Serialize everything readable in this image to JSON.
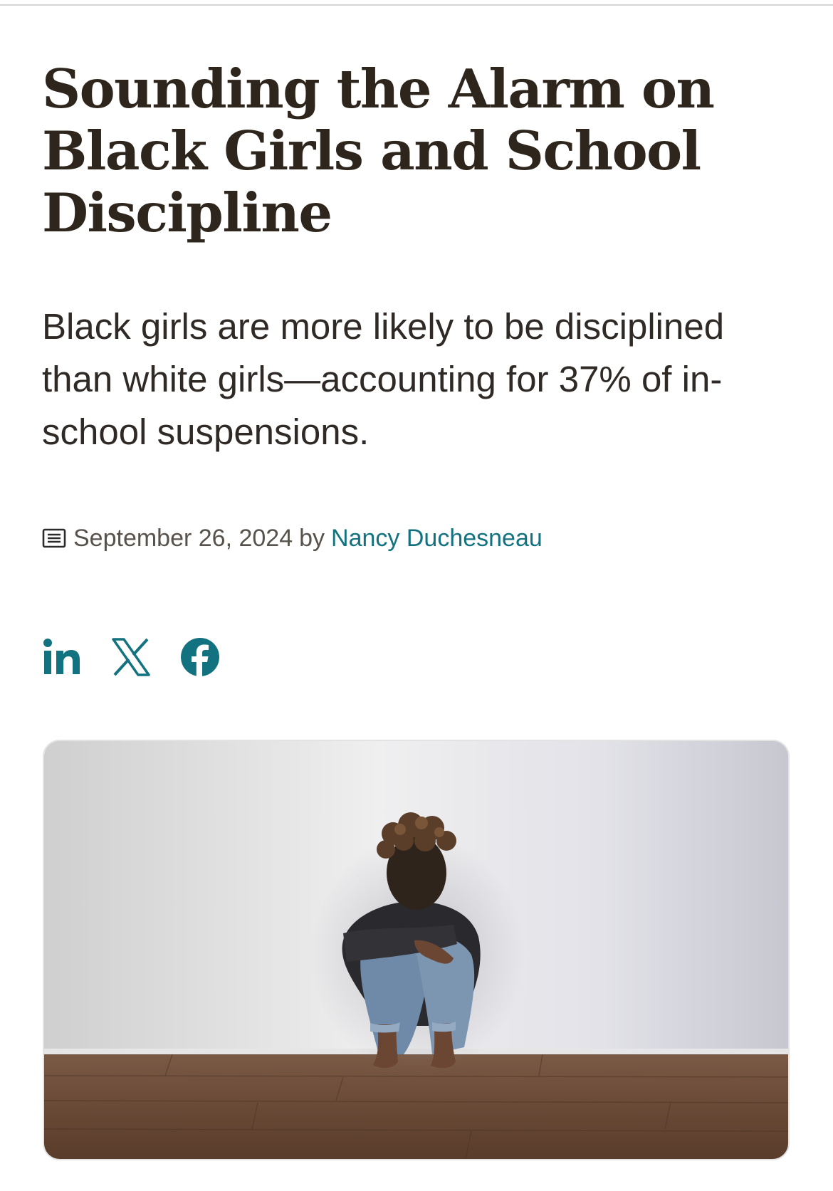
{
  "article": {
    "title": "Sounding the Alarm on Black Girls and School Discipline",
    "subtitle": "Black girls are more likely to be disciplined than white girls—accounting for 37% of in-school suspensions.",
    "date": "September 26, 2024",
    "by": "by",
    "author": "Nancy Duchesneau"
  },
  "share": {
    "icons": [
      "linkedin-icon",
      "x-icon",
      "facebook-icon"
    ],
    "color": "#13727f"
  },
  "hero": {
    "icon": "photo"
  },
  "colors": {
    "title": "#2e261c",
    "text": "#2f2a26",
    "meta": "#58524c",
    "link": "#13727f"
  }
}
